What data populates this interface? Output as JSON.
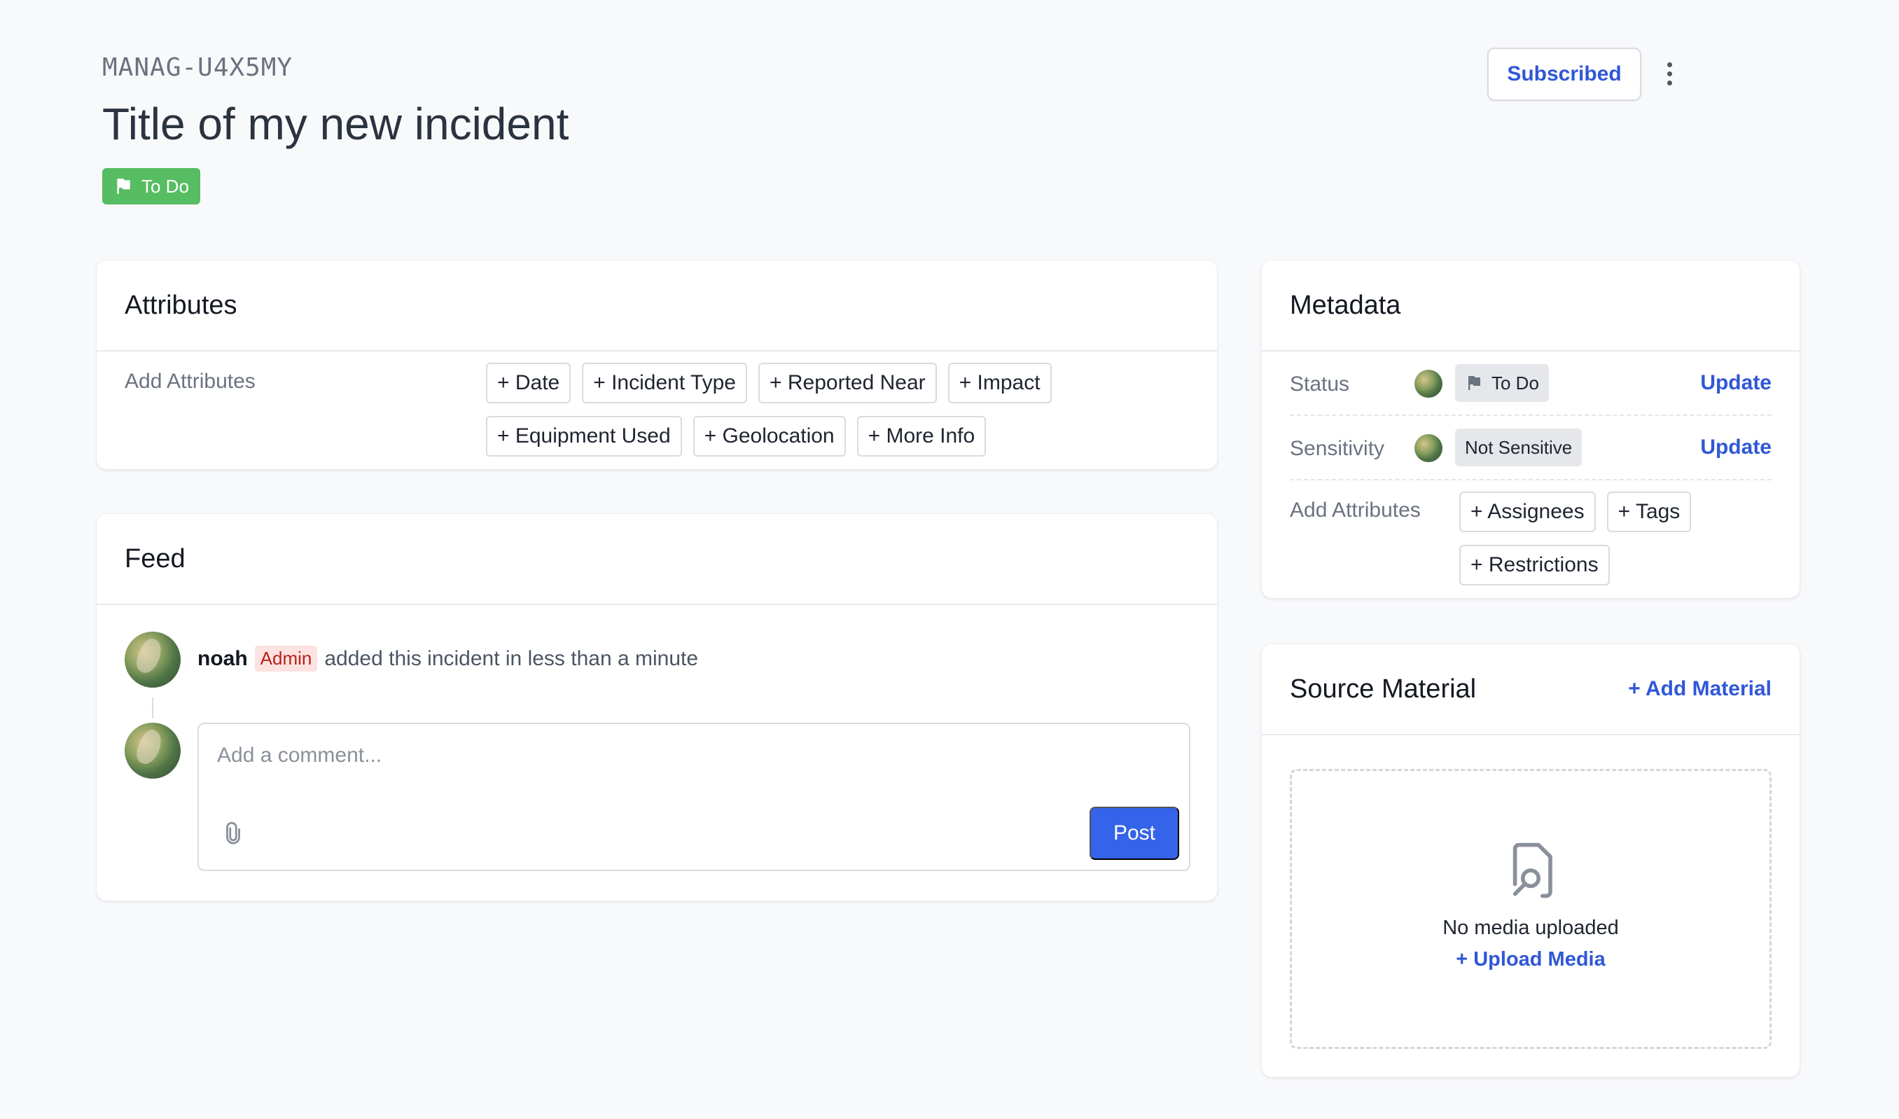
{
  "header": {
    "incident_id": "MANAG-U4X5MY",
    "title": "Title of my new incident",
    "status_label": "To Do",
    "subscribe_label": "Subscribed"
  },
  "attributes": {
    "title": "Attributes",
    "row_label": "Add Attributes",
    "chips": [
      "+ Date",
      "+ Incident Type",
      "+ Reported Near",
      "+ Impact",
      "+ Equipment Used",
      "+ Geolocation",
      "+ More Info"
    ]
  },
  "feed": {
    "title": "Feed",
    "entry": {
      "user": "noah",
      "role_badge": "Admin",
      "text": "added this incident in less than a minute"
    },
    "comment_placeholder": "Add a comment...",
    "post_label": "Post"
  },
  "metadata": {
    "title": "Metadata",
    "status": {
      "label": "Status",
      "value": "To Do",
      "action": "Update"
    },
    "sensitivity": {
      "label": "Sensitivity",
      "value": "Not Sensitive",
      "action": "Update"
    },
    "add_label": "Add Attributes",
    "chips": [
      "+ Assignees",
      "+ Tags",
      "+ Restrictions"
    ]
  },
  "source_material": {
    "title": "Source Material",
    "add_link": "+ Add Material",
    "empty_text": "No media uploaded",
    "upload_link": "+ Upload Media"
  },
  "colors": {
    "accent": "#3057d6",
    "status_green": "#56bd62",
    "post_button": "#3563e9",
    "admin_badge_bg": "#fde2e2"
  }
}
